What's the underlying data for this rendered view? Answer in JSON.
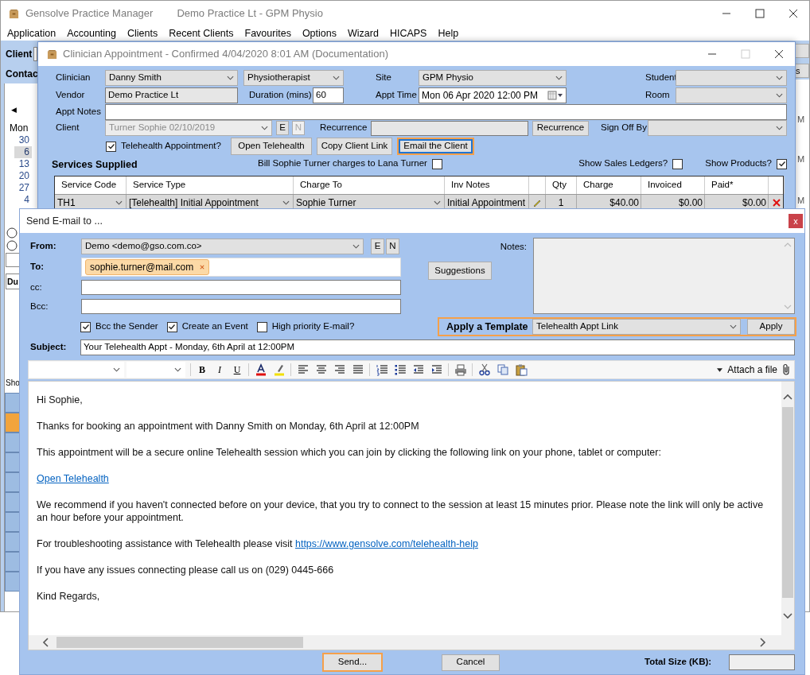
{
  "main_window": {
    "app_title": "Gensolve Practice Manager",
    "practice_title": "Demo Practice Lt - GPM Physio",
    "menu": [
      "Application",
      "Accounting",
      "Clients",
      "Recent Clients",
      "Favourites",
      "Options",
      "Wizard",
      "HICAPS",
      "Help"
    ],
    "client_label": "Client",
    "contact_label": "Contac",
    "calendar": {
      "prev": "◀",
      "day_header": "Mon",
      "dates": [
        {
          "text": "30",
          "selected": false
        },
        {
          "text": "6",
          "selected": true
        },
        {
          "text": "13",
          "selected": false
        },
        {
          "text": "20",
          "selected": false
        },
        {
          "text": "27",
          "selected": false
        },
        {
          "text": "4",
          "selected": false
        }
      ]
    },
    "radios": [
      {
        "selected": false
      },
      {
        "selected": false
      }
    ],
    "tab_fragment": "Du",
    "show_fragment": "Sho",
    "time_slots": [
      {
        "selected": false
      },
      {
        "selected": true
      },
      {
        "selected": false
      },
      {
        "selected": false
      },
      {
        "selected": false
      },
      {
        "selected": false
      },
      {
        "selected": false
      },
      {
        "selected": false
      },
      {
        "selected": false
      },
      {
        "selected": false
      }
    ],
    "right_button": "s",
    "right_fragments": [
      "M",
      "M",
      "M"
    ]
  },
  "appointment": {
    "title": "Clinician Appointment - Confirmed 4/04/2020 8:01 AM (Documentation)",
    "clinician": {
      "label": "Clinician",
      "value": "Danny Smith"
    },
    "role": "Physiotherapist",
    "site": {
      "label": "Site",
      "value": "GPM Physio"
    },
    "student": {
      "label": "Student"
    },
    "vendor": {
      "label": "Vendor",
      "value": "Demo Practice Lt"
    },
    "duration": {
      "label": "Duration (mins)",
      "value": "60"
    },
    "appt_time": {
      "label": "Appt Time",
      "value": "Mon 06 Apr 2020 12:00 PM"
    },
    "room": {
      "label": "Room"
    },
    "appt_notes": {
      "label": "Appt Notes"
    },
    "client": {
      "label": "Client",
      "value": "Turner Sophie 02/10/2019",
      "disabled": true
    },
    "client_buttons": [
      {
        "text": "E",
        "disabled": false
      },
      {
        "text": "N",
        "disabled": true
      }
    ],
    "recurrence": {
      "label": "Recurrence",
      "button": "Recurrence"
    },
    "sign_off": {
      "label": "Sign Off By"
    },
    "telehealth": {
      "label": "Telehealth Appointment?",
      "checked": true
    },
    "actions": [
      {
        "text": "Open Telehealth",
        "highlighted": false
      },
      {
        "text": "Copy Client Link",
        "highlighted": false
      },
      {
        "text": "Email the Client",
        "highlighted": true
      }
    ],
    "services_title": "Services Supplied",
    "bill": {
      "label": "Bill Sophie Turner charges to Lana Turner",
      "checked": false
    },
    "show_sales_ledgers": {
      "label": "Show Sales Ledgers?",
      "checked": false
    },
    "show_products": {
      "label": "Show Products?",
      "checked": true
    },
    "table": {
      "columns": [
        "Service Code",
        "Service Type",
        "Charge To",
        "Inv Notes",
        "Qty",
        "Charge",
        "Invoiced",
        "Paid*"
      ],
      "rows": [
        {
          "cells": [
            "TH1",
            "[Telehealth] Initial Appointment",
            "Sophie Turner",
            "Initial Appointment",
            "1",
            "$40.00",
            "$0.00",
            "$0.00"
          ]
        }
      ]
    }
  },
  "email": {
    "title": "Send E-mail to ...",
    "close": "x",
    "from": {
      "label": "From:",
      "value": "Demo <demo@gso.com.co>"
    },
    "from_buttons": [
      "E",
      "N"
    ],
    "to": {
      "label": "To:",
      "recipients": [
        "sophie.turner@mail.com"
      ]
    },
    "cc_label": "cc:",
    "bcc_label": "Bcc:",
    "suggestions": "Suggestions",
    "notes_label": "Notes:",
    "options": [
      {
        "label": "Bcc the Sender",
        "checked": true
      },
      {
        "label": "Create an Event",
        "checked": true
      },
      {
        "label": "High priority E-mail?",
        "checked": false
      }
    ],
    "template": {
      "label": "Apply a Template",
      "value": "Telehealth Appt Link",
      "button": "Apply",
      "highlighted": true
    },
    "subject": {
      "label": "Subject:",
      "value": "Your Telehealth Appt -  Monday, 6th April at 12:00PM"
    },
    "toolbar": {
      "format": [
        "B",
        "I",
        "U"
      ],
      "attach": "Attach a file"
    },
    "body": [
      {
        "text": "Hi Sophie,"
      },
      {
        "text": "Thanks for booking an appointment with Danny Smith on Monday, 6th April at 12:00PM"
      },
      {
        "text": "This appointment will be a secure online Telehealth session which you can join by clicking the following link on your phone, tablet or computer:"
      },
      {
        "link": "Open Telehealth"
      },
      {
        "text": "We recommend if you haven't connected before on your device, that you try to connect to the session at least 15 minutes prior. Please note the link will only be active an hour before your appointment."
      },
      {
        "text": "For troubleshooting assistance with Telehealth please visit",
        "link": "https://www.gensolve.com/telehealth-help"
      },
      {
        "text": "If you have any issues connecting please call us on (029) 0445-666"
      },
      {
        "text": "Kind Regards,"
      }
    ],
    "send": {
      "text": "Send...",
      "highlighted": true
    },
    "cancel": "Cancel",
    "total_size_label": "Total Size (KB):"
  }
}
